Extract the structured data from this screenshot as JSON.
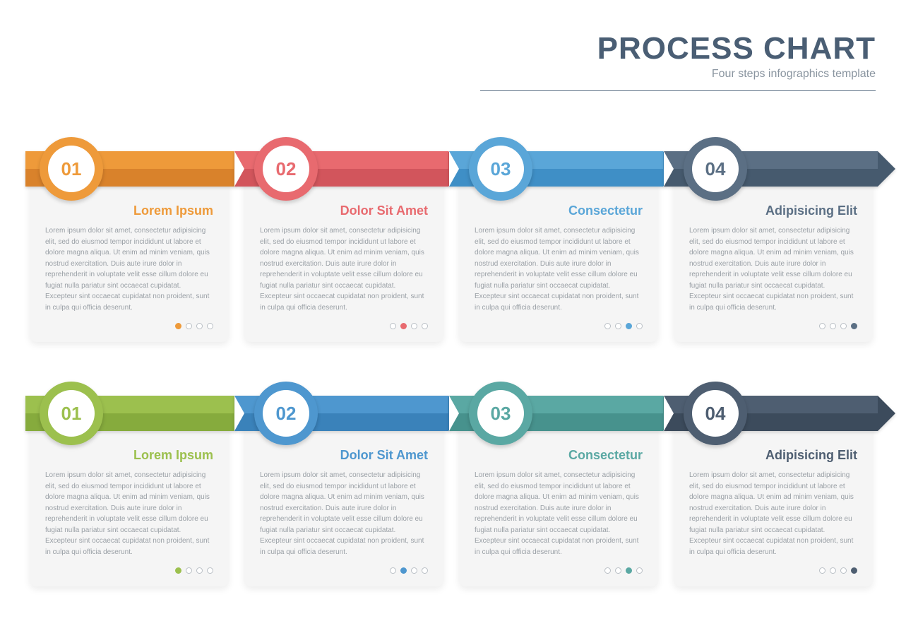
{
  "header": {
    "title": "PROCESS CHART",
    "subtitle": "Four steps infographics template"
  },
  "body_text": "Lorem ipsum dolor sit amet, consectetur adipisicing elit, sed do eiusmod tempor incididunt ut labore et dolore magna aliqua. Ut enim ad minim veniam, quis nostrud exercitation. Duis aute irure dolor in reprehenderit in voluptate velit esse cillum dolore eu fugiat nulla pariatur sint occaecat cupidatat. Excepteur sint occaecat cupidatat non proident, sunt in culpa qui officia deserunt.",
  "rows": [
    {
      "steps": [
        {
          "num": "01",
          "title": "Lorem Ipsum",
          "color": "#ee9a3a",
          "dark": "#d9822b"
        },
        {
          "num": "02",
          "title": "Dolor Sit Amet",
          "color": "#e86a6f",
          "dark": "#d2555c"
        },
        {
          "num": "03",
          "title": "Consectetur",
          "color": "#5aa6d8",
          "dark": "#3f8fc6"
        },
        {
          "num": "04",
          "title": "Adipisicing Elit",
          "color": "#5b6f84",
          "dark": "#465a6e"
        }
      ]
    },
    {
      "steps": [
        {
          "num": "01",
          "title": "Lorem Ipsum",
          "color": "#9cc04e",
          "dark": "#86ab3d"
        },
        {
          "num": "02",
          "title": "Dolor Sit Amet",
          "color": "#4e97cf",
          "dark": "#3a82ba"
        },
        {
          "num": "03",
          "title": "Consectetur",
          "color": "#5aa8a3",
          "dark": "#47928d"
        },
        {
          "num": "04",
          "title": "Adipisicing Elit",
          "color": "#4e5e71",
          "dark": "#3c4b5c"
        }
      ]
    }
  ]
}
